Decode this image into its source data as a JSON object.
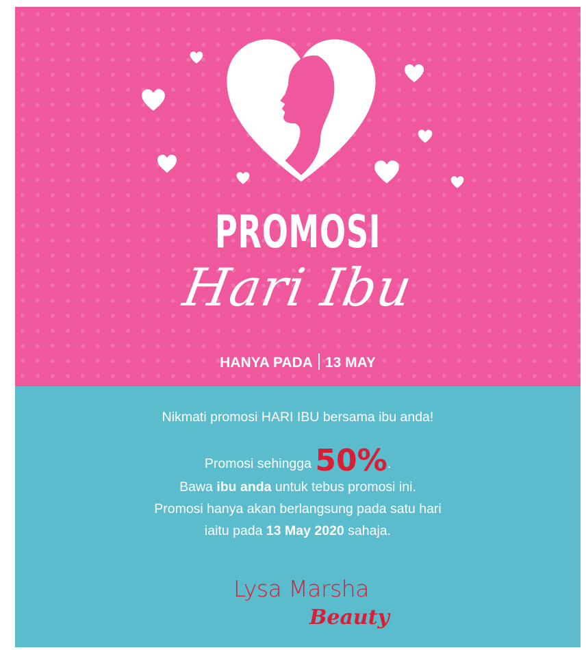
{
  "header": {
    "title": "PROMOSI",
    "script_title": "Hari Ibu",
    "date_prefix": "HANYA PADA",
    "date_value": "13 MAY"
  },
  "body": {
    "tagline": "Nikmati promosi HARI IBU bersama ibu anda!",
    "promo_prefix": "Promosi sehingga ",
    "promo_value": "50%",
    "promo_suffix": ".",
    "bawa_prefix": "Bawa ",
    "bawa_bold": "ibu anda",
    "bawa_suffix": " untuk tebus promosi ini.",
    "only_line": "Promosi hanya akan berlangsung pada satu hari",
    "iaitu_prefix": "iaitu pada ",
    "iaitu_bold": "13 May 2020",
    "iaitu_suffix": " sahaja."
  },
  "brand": {
    "name_line1": "Lysa Marsha",
    "name_line2": "Beauty"
  },
  "colors": {
    "pink_background": "#f0589e",
    "teal_background": "#5bbccd",
    "accent_red": "#d81e35",
    "text_white": "#ffffff"
  },
  "icons": [
    "heart-woman-silhouette-icon",
    "heart-icon"
  ]
}
